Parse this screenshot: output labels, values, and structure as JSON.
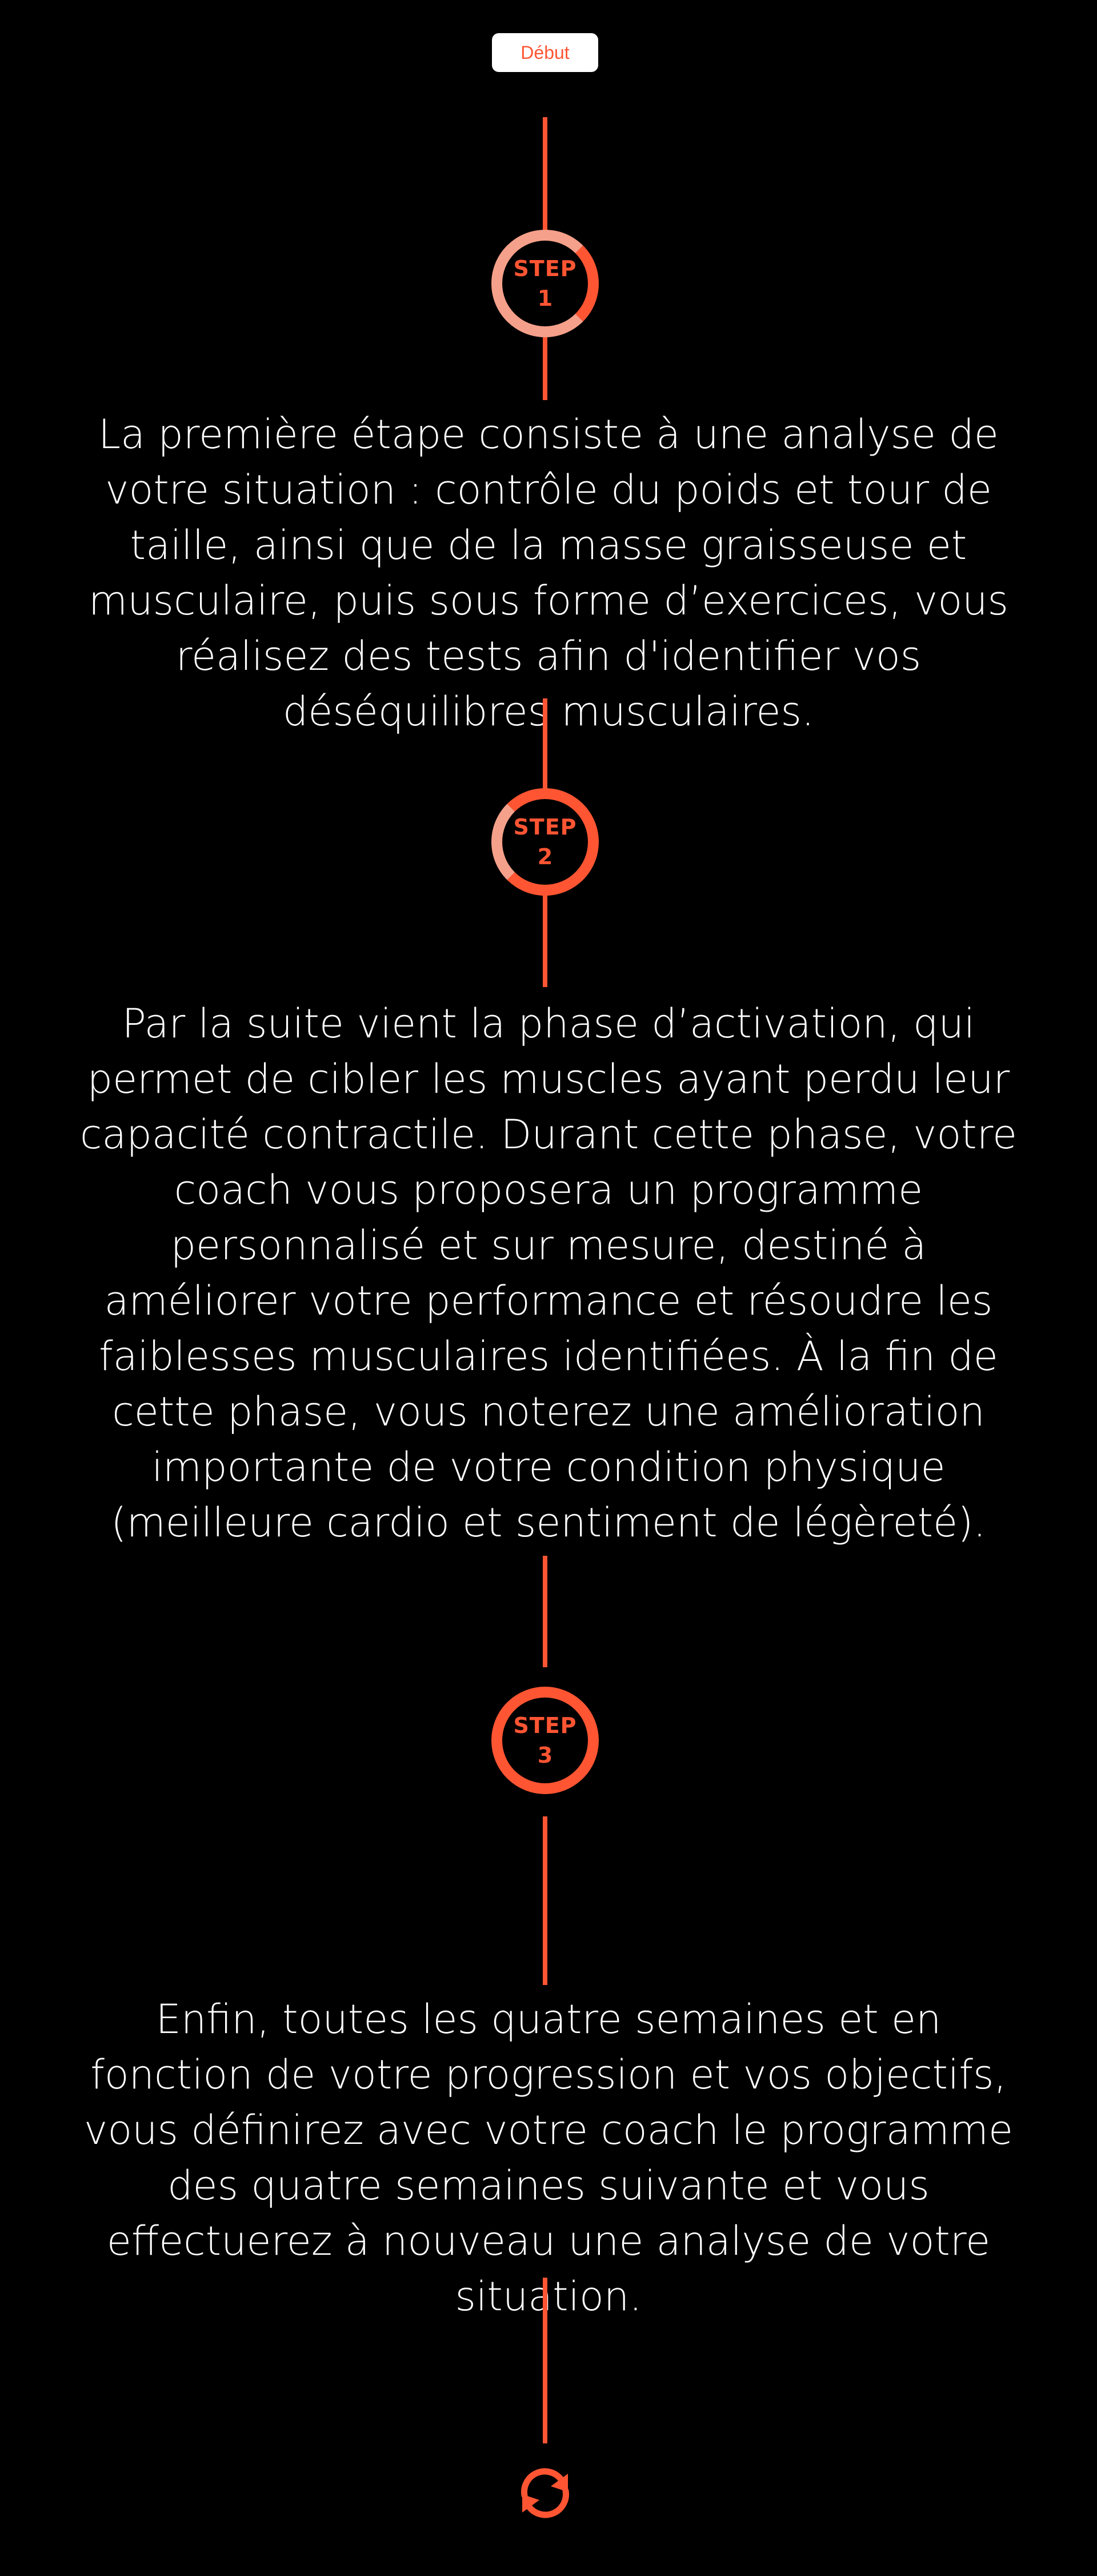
{
  "start_label": "Début",
  "steps": [
    {
      "word": "STEP",
      "number": "1",
      "text": "La première étape consiste à une analyse de votre situation : contrôle du poids et tour de taille, ainsi que de la masse graisseuse et musculaire, puis sous forme d’exercices, vous réalisez des tests afin d'identifier vos déséquilibres musculaires."
    },
    {
      "word": "STEP",
      "number": "2",
      "text": "Par la suite vient la phase d’activation, qui permet de cibler les muscles ayant perdu leur capacité contractile. Durant cette phase, votre coach vous proposera un programme personnalisé et sur mesure, destiné à améliorer votre performance et résoudre les faiblesses musculaires identifiées. À la fin de cette phase, vous noterez une amélioration importante de votre condition physique (meilleure cardio et sentiment de légèreté)."
    },
    {
      "word": "STEP",
      "number": "3",
      "text": "Enfin, toutes les quatre semaines et en fonction de votre progression et vos objectifs, vous définirez avec votre coach le programme des quatre semaines suivante et vous effectuerez à nouveau une analyse de votre situation."
    }
  ],
  "icons": {
    "end": "refresh-cycle-icon"
  },
  "colors": {
    "accent": "#ff5533",
    "accent_light": "#f5a08a",
    "background": "#000000",
    "text": "#ffffff"
  }
}
